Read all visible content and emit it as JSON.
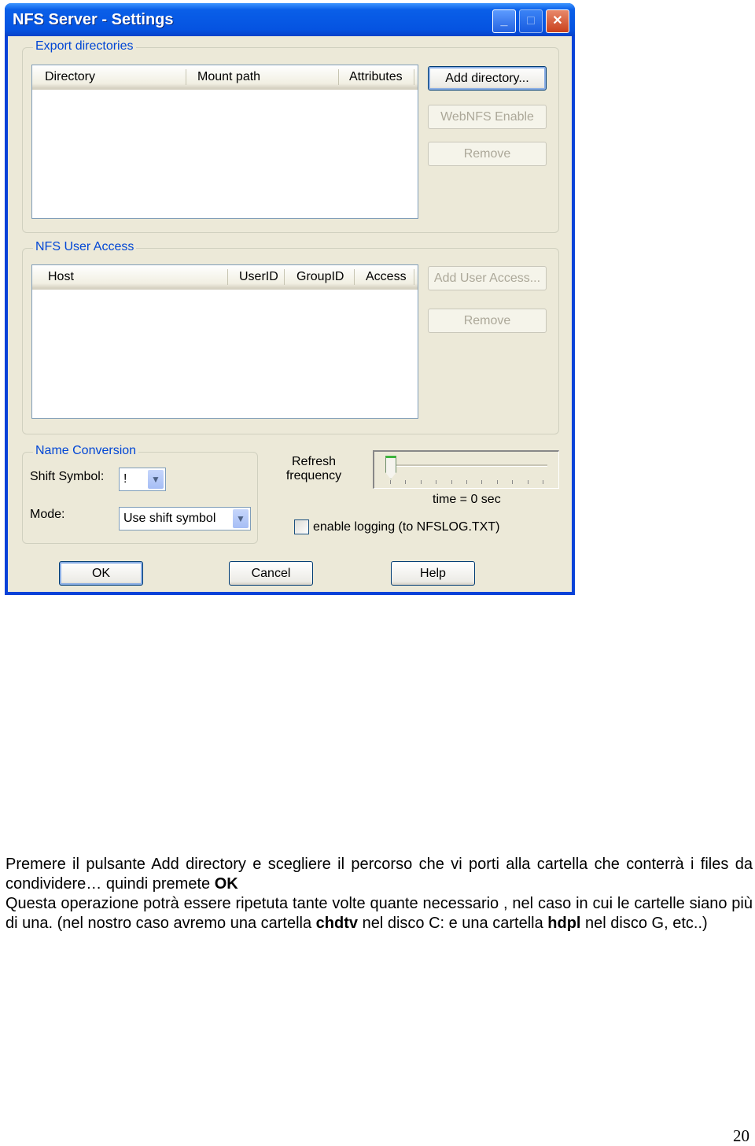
{
  "window": {
    "title": "NFS Server - Settings",
    "controls": {
      "minimize": "minimize-icon",
      "maximize": "maximize-icon",
      "close": "close-icon"
    }
  },
  "export": {
    "legend": "Export directories",
    "columns": [
      "Directory",
      "Mount path",
      "Attributes"
    ],
    "buttons": {
      "add": "Add directory...",
      "webnfs": "WebNFS Enable",
      "remove": "Remove"
    }
  },
  "access": {
    "legend": "NFS User Access",
    "columns": [
      "Host",
      "UserID",
      "GroupID",
      "Access"
    ],
    "buttons": {
      "add": "Add User Access...",
      "remove": "Remove"
    }
  },
  "naming": {
    "legend": "Name Conversion",
    "shift_label": "Shift Symbol:",
    "shift_value": "!",
    "mode_label": "Mode:",
    "mode_value": "Use shift symbol"
  },
  "refresh": {
    "label1": "Refresh",
    "label2": "frequency",
    "value": 0,
    "time_text": "time = 0 sec",
    "logging_label": "enable logging (to NFSLOG.TXT)",
    "logging_checked": false
  },
  "footer": {
    "ok": "OK",
    "cancel": "Cancel",
    "help": "Help"
  },
  "document": {
    "p1_a": "Premere il pulsante Add directory e scegliere il percorso che vi porti alla cartella che conterrà i files da condividere… quindi premete ",
    "p1_b": "OK",
    "p2_a": "Questa operazione potrà essere ripetuta tante volte quante necessario , nel caso in cui le cartelle siano più di una. (nel nostro caso avremo una cartella ",
    "p2_b": "chdtv",
    "p2_c": " nel disco C: e una cartella ",
    "p2_d": "hdpl",
    "p2_e": " nel disco G, etc..)",
    "page_number": "20"
  }
}
